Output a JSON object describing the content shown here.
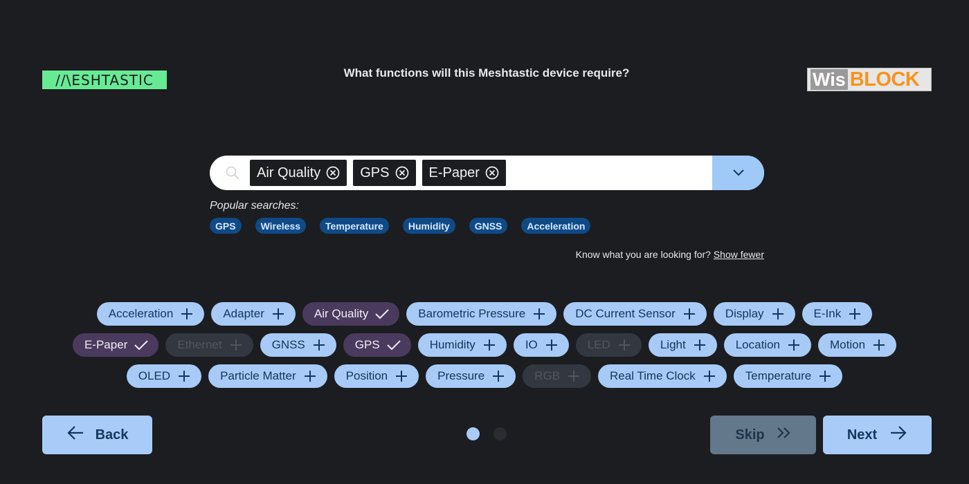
{
  "logo_left": "//\\ESHTASTIC",
  "logo_right": {
    "part1": "Wis",
    "part2": "BLOCK"
  },
  "prompt": "What functions will this Meshtastic device require?",
  "search": {
    "chips": [
      "Air Quality",
      "GPS",
      "E-Paper"
    ]
  },
  "popular": {
    "label": "Popular searches:",
    "items": [
      "GPS",
      "Wireless",
      "Temperature",
      "Humidity",
      "GNSS",
      "Acceleration"
    ]
  },
  "know": {
    "text": "Know what you are looking for?",
    "link": "Show fewer"
  },
  "tags": {
    "row1": [
      {
        "label": "Acceleration",
        "state": "available"
      },
      {
        "label": "Adapter",
        "state": "available"
      },
      {
        "label": "Air Quality",
        "state": "selected"
      },
      {
        "label": "Barometric Pressure",
        "state": "available"
      },
      {
        "label": "DC Current Sensor",
        "state": "available"
      },
      {
        "label": "Display",
        "state": "available"
      },
      {
        "label": "E-Ink",
        "state": "available"
      }
    ],
    "row2": [
      {
        "label": "E-Paper",
        "state": "selected"
      },
      {
        "label": "Ethernet",
        "state": "disabled"
      },
      {
        "label": "GNSS",
        "state": "available"
      },
      {
        "label": "GPS",
        "state": "selected"
      },
      {
        "label": "Humidity",
        "state": "available"
      },
      {
        "label": "IO",
        "state": "available"
      },
      {
        "label": "LED",
        "state": "disabled"
      },
      {
        "label": "Light",
        "state": "available"
      },
      {
        "label": "Location",
        "state": "available"
      },
      {
        "label": "Motion",
        "state": "available"
      }
    ],
    "row3": [
      {
        "label": "OLED",
        "state": "available"
      },
      {
        "label": "Particle Matter",
        "state": "available"
      },
      {
        "label": "Position",
        "state": "available"
      },
      {
        "label": "Pressure",
        "state": "available"
      },
      {
        "label": "RGB",
        "state": "disabled"
      },
      {
        "label": "Real Time Clock",
        "state": "available"
      },
      {
        "label": "Temperature",
        "state": "available"
      }
    ]
  },
  "buttons": {
    "back": "Back",
    "skip": "Skip",
    "next": "Next"
  },
  "pagination": {
    "total": 2,
    "current": 1
  },
  "colors": {
    "brand_green": "#67ea94",
    "accent_blue": "#a8ccf7",
    "selected_purple": "#4a3a5e",
    "background": "#1c1d20"
  }
}
